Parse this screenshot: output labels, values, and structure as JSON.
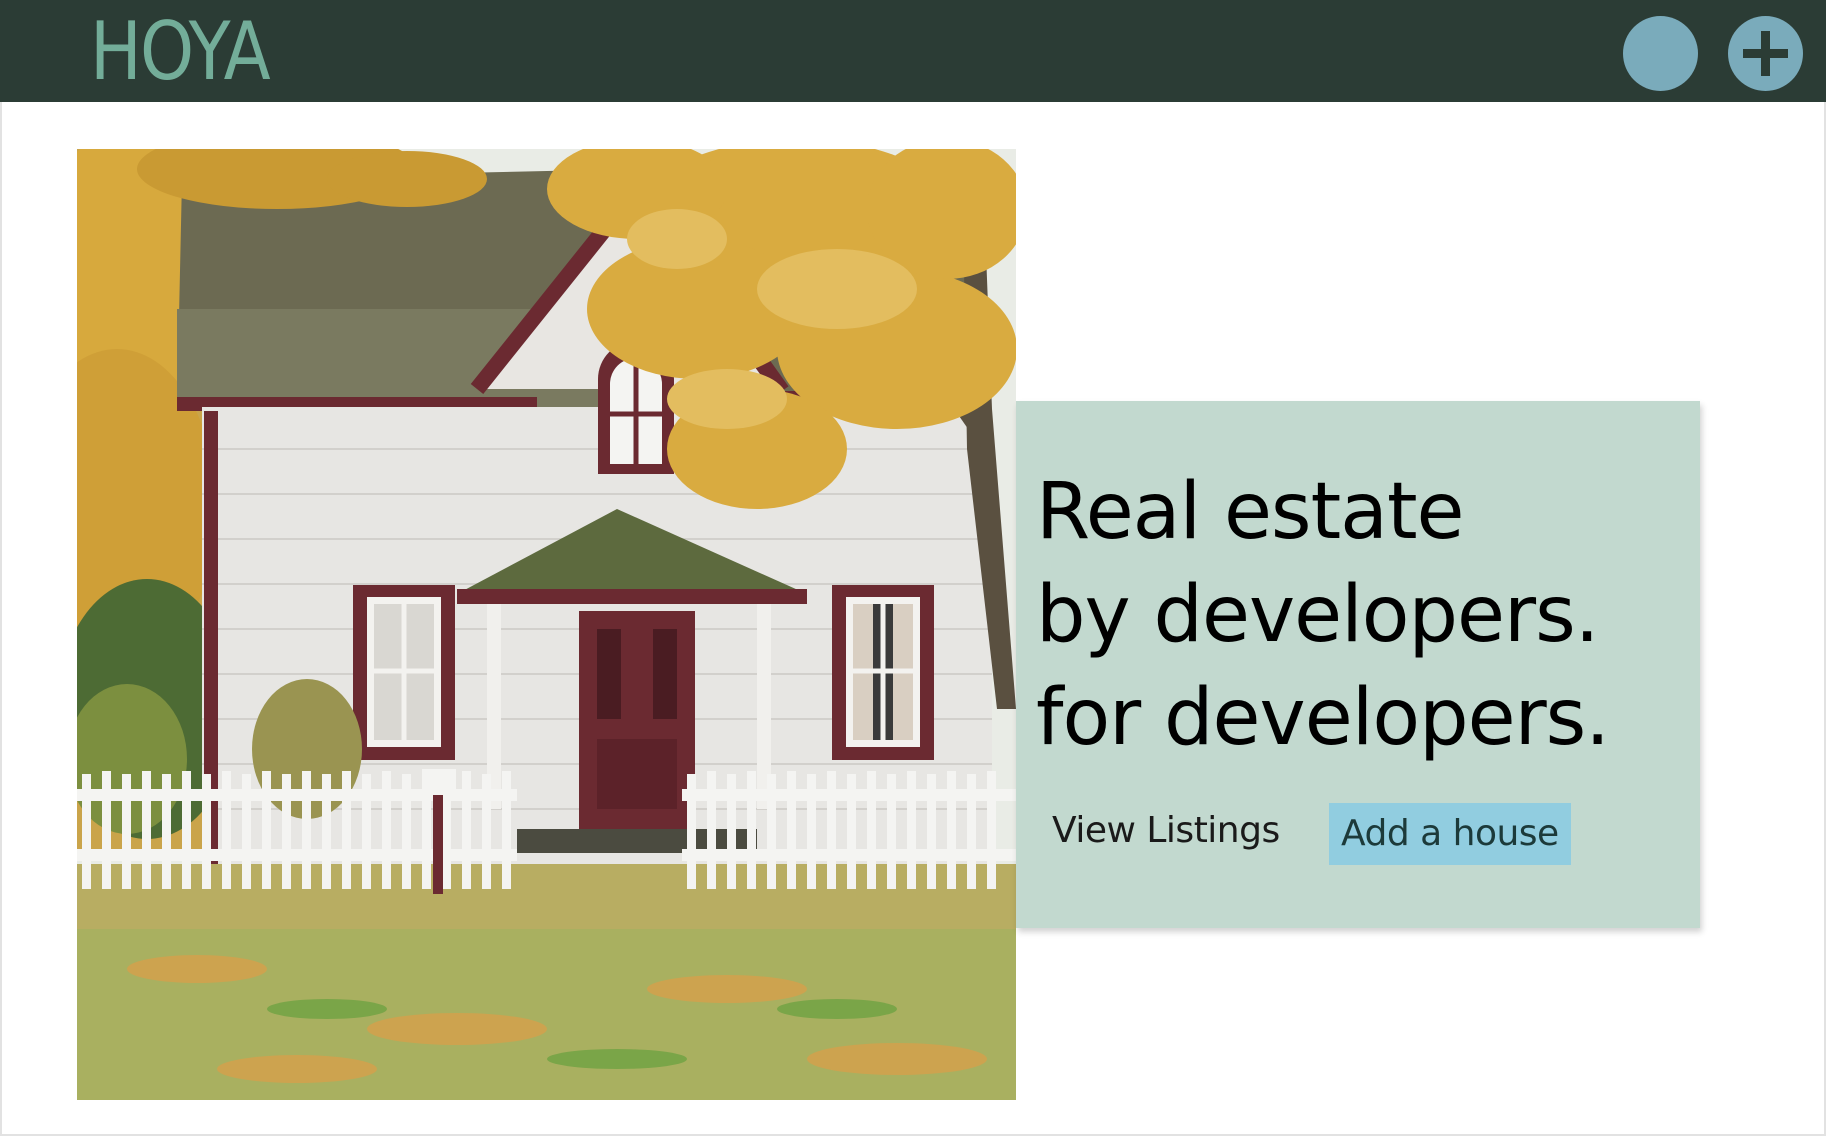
{
  "navbar": {
    "brand": "HOYA",
    "avatar_icon": "user-avatar-icon",
    "add_icon": "plus-circle-icon",
    "background_color": "#2b3c35",
    "brand_color": "#73ad99",
    "icon_color": "#7aabbb"
  },
  "hero": {
    "image_alt": "White house with red trim behind a picket fence under an autumn tree",
    "headline_lines": [
      "Real estate",
      "by developers.",
      "for developers."
    ],
    "view_listings_label": "View Listings",
    "add_house_label": "Add a house",
    "card_color": "#c2d9cf",
    "accent_color": "#91cde0"
  }
}
